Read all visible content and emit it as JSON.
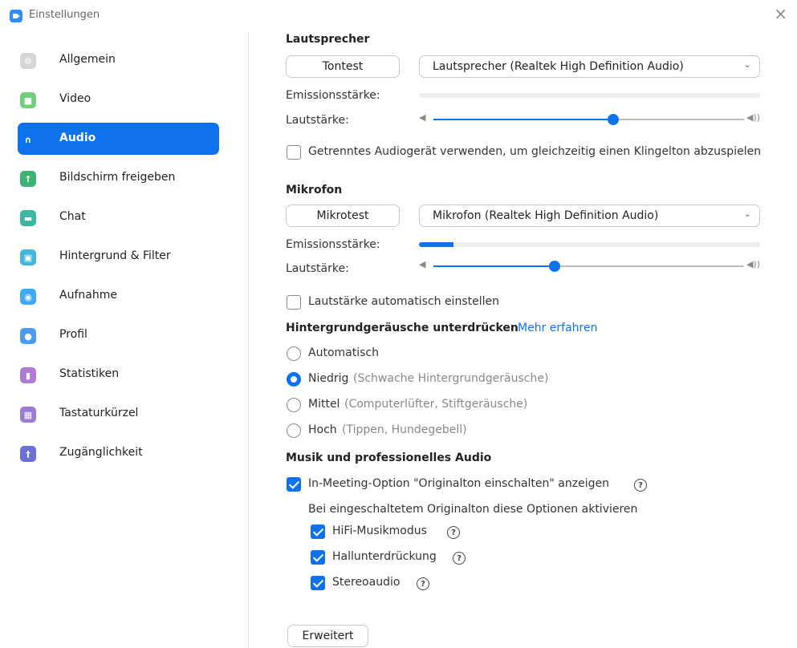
{
  "window": {
    "title": "Einstellungen",
    "close_glyph": "×"
  },
  "sidebar": {
    "items": [
      {
        "label": "Allgemein",
        "icon": "gear-icon",
        "color": "#D6D6D6",
        "glyph": "⚙"
      },
      {
        "label": "Video",
        "icon": "video-camera-icon",
        "color": "#6FCF7A",
        "glyph": "■"
      },
      {
        "label": "Audio",
        "icon": "headphones-icon",
        "color": "#0E72ED",
        "glyph": "∩"
      },
      {
        "label": "Bildschirm freigeben",
        "icon": "share-screen-icon",
        "color": "#3CB371",
        "glyph": "↑"
      },
      {
        "label": "Chat",
        "icon": "chat-bubble-icon",
        "color": "#3BB7A2",
        "glyph": "▬"
      },
      {
        "label": "Hintergrund & Filter",
        "icon": "background-icon",
        "color": "#45B6D8",
        "glyph": "▣"
      },
      {
        "label": "Aufnahme",
        "icon": "record-icon",
        "color": "#3FA9F5",
        "glyph": "◉"
      },
      {
        "label": "Profil",
        "icon": "profile-icon",
        "color": "#4A9CF0",
        "glyph": "●"
      },
      {
        "label": "Statistiken",
        "icon": "statistics-icon",
        "color": "#B07BD6",
        "glyph": "▮"
      },
      {
        "label": "Tastaturkürzel",
        "icon": "keyboard-icon",
        "color": "#9C7BD6",
        "glyph": "▦"
      },
      {
        "label": "Zugänglichkeit",
        "icon": "accessibility-icon",
        "color": "#6B6FD6",
        "glyph": "†"
      }
    ],
    "active_index": 2
  },
  "speaker": {
    "title": "Lautsprecher",
    "test_button": "Tontest",
    "device": "Lautsprecher (Realtek High Definition Audio)",
    "emission_label": "Emissionsstärke:",
    "emission_level": 0.0,
    "volume_label": "Lautstärke:",
    "volume": 0.58,
    "separate_device_label": "Getrenntes Audiogerät verwenden, um gleichzeitig einen Klingelton abzuspielen",
    "separate_device_checked": false
  },
  "microphone": {
    "title": "Mikrofon",
    "test_button": "Mikrotest",
    "device": "Mikrofon (Realtek High Definition Audio)",
    "emission_label": "Emissionsstärke:",
    "emission_level": 0.1,
    "volume_label": "Lautstärke:",
    "volume": 0.39,
    "auto_volume_label": "Lautstärke automatisch einstellen",
    "auto_volume_checked": false
  },
  "noise": {
    "title": "Hintergrundgeräusche unterdrücken",
    "learn_more": "Mehr erfahren",
    "options": [
      {
        "label": "Automatisch",
        "hint": ""
      },
      {
        "label": "Niedrig",
        "hint": "(Schwache Hintergrundgeräusche)"
      },
      {
        "label": "Mittel",
        "hint": "(Computerlüfter, Stiftgeräusche)"
      },
      {
        "label": "Hoch",
        "hint": "(Tippen, Hundegebell)"
      }
    ],
    "selected": 1
  },
  "music": {
    "title": "Musik und professionelles Audio",
    "original_sound_label": "In-Meeting-Option \"Originalton einschalten\" anzeigen",
    "original_sound_checked": true,
    "sub_caption": "Bei eingeschaltetem Originalton diese Optionen aktivieren",
    "sub_options": [
      {
        "label": "HiFi-Musikmodus",
        "checked": true
      },
      {
        "label": "Hallunterdrückung",
        "checked": true
      },
      {
        "label": "Stereoaudio",
        "checked": true
      }
    ]
  },
  "advanced_button": "Erweitert",
  "glyphs": {
    "help": "?",
    "chevron": "⌄",
    "speaker_low": "◀",
    "speaker_high": "◀))"
  }
}
